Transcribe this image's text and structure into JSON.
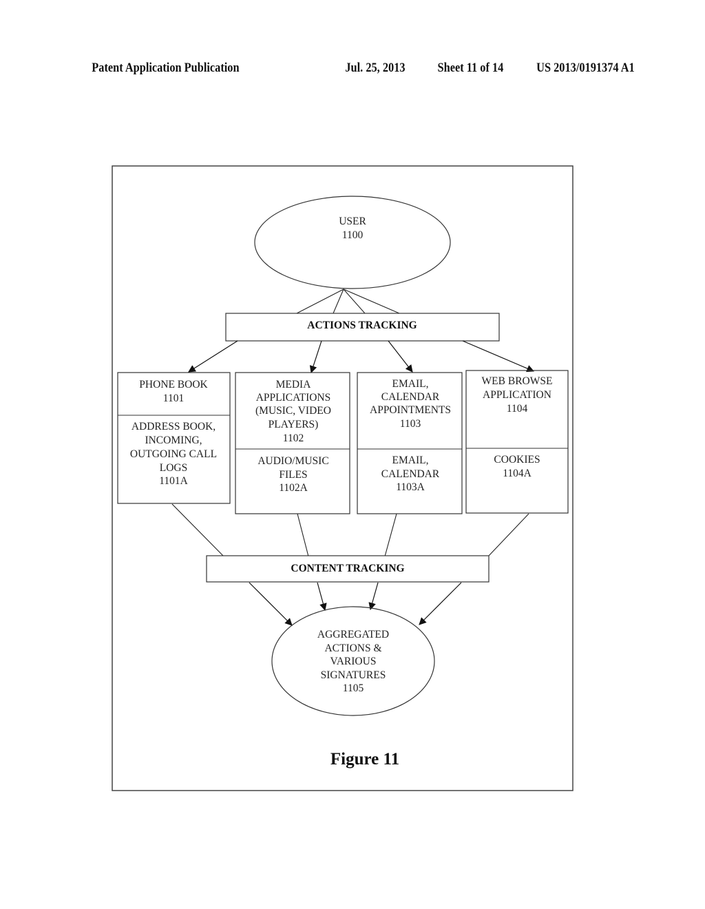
{
  "header": {
    "publication": "Patent Application Publication",
    "date": "Jul. 25, 2013",
    "sheet": "Sheet 11 of 14",
    "patent_number": "US 2013/0191374 A1"
  },
  "diagram": {
    "user": {
      "lines": [
        "USER",
        "1100"
      ]
    },
    "actions_tracking": "ACTIONS TRACKING",
    "content_tracking": "CONTENT TRACKING",
    "boxes": [
      {
        "top_lines": [
          "PHONE BOOK",
          "1101"
        ],
        "bottom_lines": [
          "ADDRESS BOOK,",
          "INCOMING,",
          "OUTGOING CALL",
          "LOGS",
          "1101A"
        ]
      },
      {
        "top_lines": [
          "MEDIA",
          "APPLICATIONS",
          "(MUSIC, VIDEO",
          "PLAYERS)",
          "1102"
        ],
        "bottom_lines": [
          "AUDIO/MUSIC",
          "FILES",
          "1102A"
        ]
      },
      {
        "top_lines": [
          "EMAIL,",
          "CALENDAR",
          "APPOINTMENTS",
          "1103"
        ],
        "bottom_lines": [
          "EMAIL,",
          "CALENDAR",
          "1103A"
        ]
      },
      {
        "top_lines": [
          "WEB BROWSE",
          "APPLICATION",
          "1104"
        ],
        "bottom_lines": [
          "COOKIES",
          "1104A"
        ]
      }
    ],
    "aggregate": {
      "lines": [
        "AGGREGATED",
        "ACTIONS &",
        "VARIOUS",
        "SIGNATURES",
        "1105"
      ]
    },
    "caption": "Figure 11"
  }
}
